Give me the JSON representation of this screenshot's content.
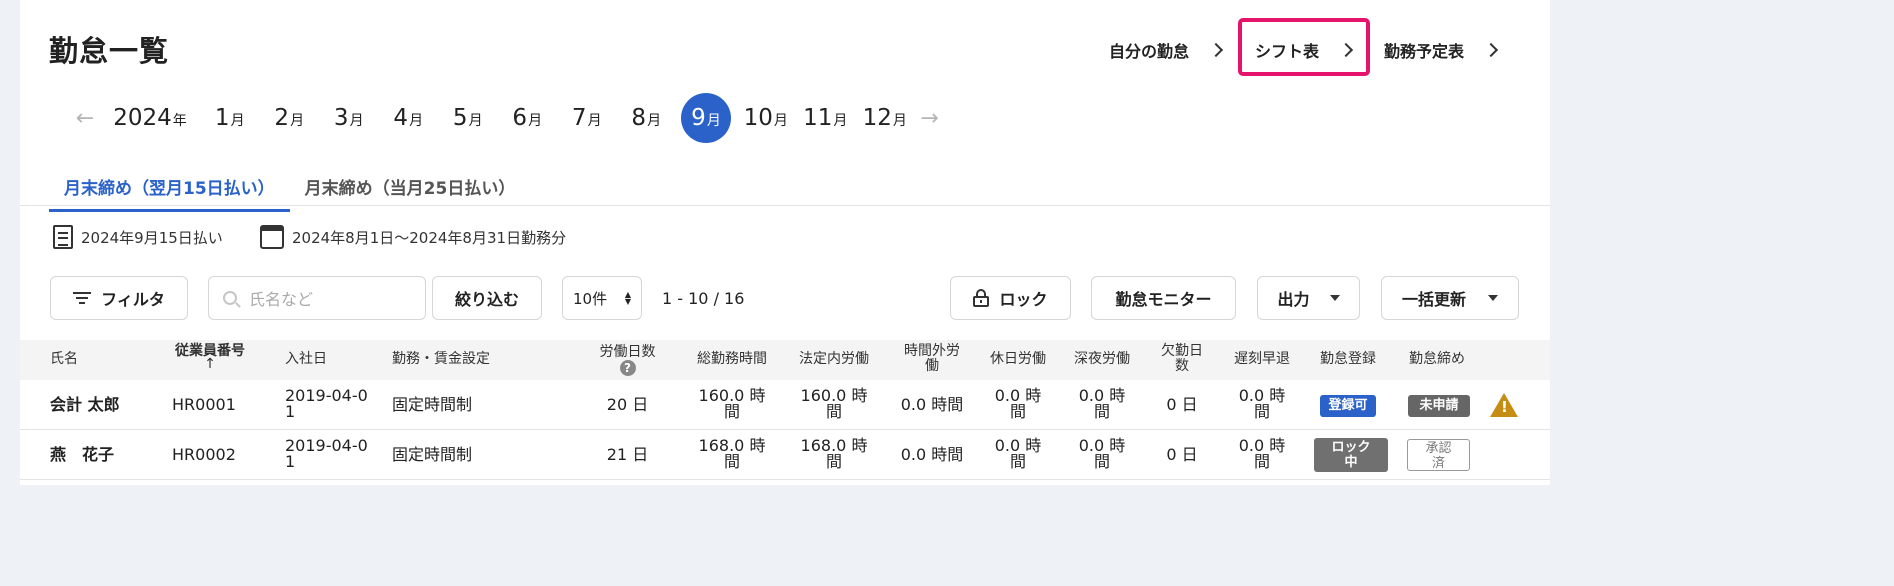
{
  "page": {
    "title": "勤怠一覧"
  },
  "top_links": {
    "my_attendance": "自分の勤怠",
    "shift_table": "シフト表",
    "schedule_table": "勤務予定表"
  },
  "month_nav": {
    "year": "2024",
    "year_unit": "年",
    "month_unit": "月",
    "months": [
      "1",
      "2",
      "3",
      "4",
      "5",
      "6",
      "7",
      "8",
      "9",
      "10",
      "11",
      "12"
    ],
    "selected": "9"
  },
  "tabs": [
    "月末締め（翌月15日払い）",
    "月末締め（当月25日払い）"
  ],
  "info": {
    "payday": "2024年9月15日払い",
    "period": "2024年8月1日〜2024年8月31日勤務分"
  },
  "toolbar": {
    "filter": "フィルタ",
    "search_placeholder": "氏名など",
    "narrow": "絞り込む",
    "per_page": "10件",
    "pagination": "1 - 10 / 16",
    "lock": "ロック",
    "monitor": "勤怠モニター",
    "output": "出力",
    "bulk_update": "一括更新"
  },
  "table": {
    "headers": {
      "name": "氏名",
      "employee_no": "従業員番号",
      "hire_date": "入社日",
      "work_setting": "勤務・賃金設定",
      "work_days": "労働日数",
      "total_hours": "総勤務時間",
      "legal_hours_l1": "法定内労働",
      "overtime_l1": "時間外労",
      "overtime_l2": "働",
      "holiday": "休日労働",
      "night": "深夜労働",
      "absent_l1": "欠勤日",
      "absent_l2": "数",
      "late": "遅刻早退",
      "registration": "勤怠登録",
      "closing": "勤怠締め"
    },
    "rows": [
      {
        "name": "会計 太郎",
        "employee_no": "HR0001",
        "hire_l1": "2019-04-0",
        "hire_l2": "1",
        "setting": "固定時間制",
        "days": "20 日",
        "total_l1": "160.0 時",
        "total_l2": "間",
        "legal_l1": "160.0 時",
        "legal_l2": "間",
        "overtime": "0.0 時間",
        "holiday_l1": "0.0 時",
        "holiday_l2": "間",
        "night_l1": "0.0 時",
        "night_l2": "間",
        "absent": "0 日",
        "late_l1": "0.0 時",
        "late_l2": "間",
        "registration": "登録可",
        "closing": "未申請",
        "warning": "!"
      },
      {
        "name": "燕　花子",
        "employee_no": "HR0002",
        "hire_l1": "2019-04-0",
        "hire_l2": "1",
        "setting": "固定時間制",
        "days": "21 日",
        "total_l1": "168.0 時",
        "total_l2": "間",
        "legal_l1": "168.0 時",
        "legal_l2": "間",
        "overtime": "0.0 時間",
        "holiday_l1": "0.0 時",
        "holiday_l2": "間",
        "night_l1": "0.0 時",
        "night_l2": "間",
        "absent": "0 日",
        "late_l1": "0.0 時",
        "late_l2": "間",
        "registration_l1": "ロック",
        "registration_l2": "中",
        "closing_l1": "承認",
        "closing_l2": "済"
      }
    ]
  },
  "colors": {
    "accent": "#2a62c9",
    "highlight": "#e5136c",
    "warning": "#c58e12"
  }
}
